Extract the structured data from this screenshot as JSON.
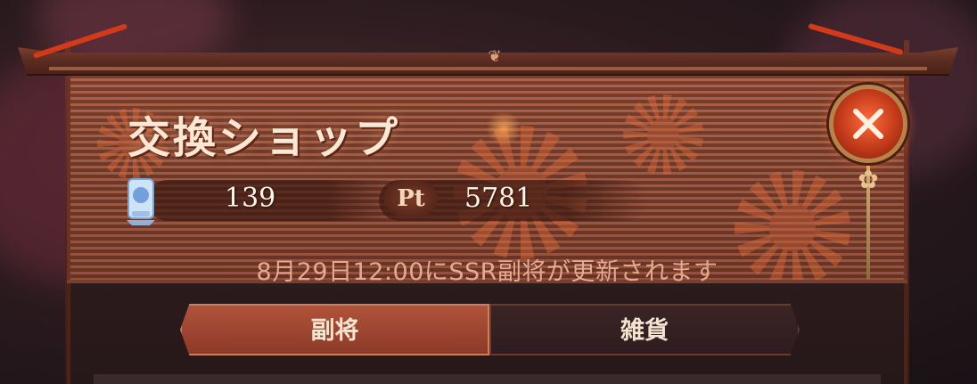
{
  "shop": {
    "title": "交換ショップ",
    "currencies": [
      {
        "icon": "ticket-icon",
        "amount": "139"
      },
      {
        "badge": "Pt",
        "amount": "5781"
      }
    ],
    "notice": "8月29日12:00にSSR副将が更新されます",
    "tabs": [
      {
        "label": "副将",
        "active": true
      },
      {
        "label": "雑貨",
        "active": false
      }
    ]
  },
  "colors": {
    "accent": "#c23a1a",
    "title_text": "#fbe8d4",
    "notice_text": "#e7a98f",
    "panel_wood": "#96503a"
  }
}
